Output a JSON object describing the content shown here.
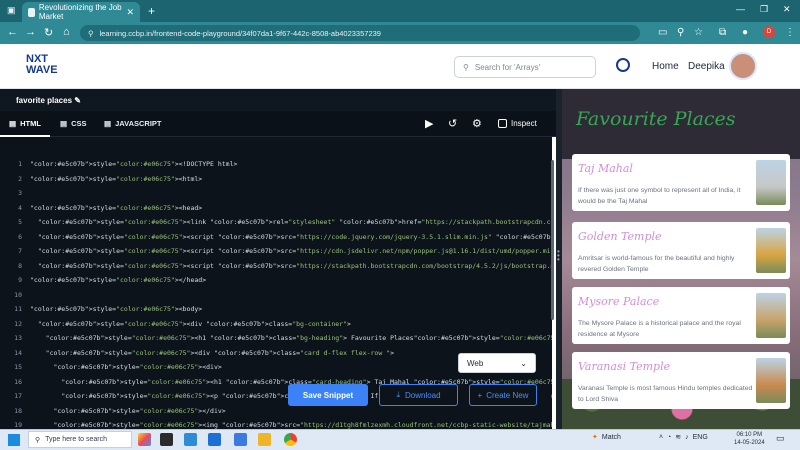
{
  "browser": {
    "tab_title": "Revolutionizing the Job Market",
    "url": "learning.ccbp.in/frontend-code-playground/34f07da1-9f67-442c-8508-ab4023357239",
    "profile_initial": "D"
  },
  "site": {
    "logo_line1": "NXT",
    "logo_line2": "WAVE",
    "search_placeholder": "Search for 'Arrays'",
    "nav_home": "Home",
    "user_name": "Deepika"
  },
  "editor": {
    "title": "favorite places",
    "tabs": [
      "HTML",
      "CSS",
      "JAVASCRIPT"
    ],
    "active_tab": "HTML",
    "inspect_label": "Inspect",
    "lines": [
      {
        "n": "1",
        "t": "<!DOCTYPE html>"
      },
      {
        "n": "2",
        "t": "<html>"
      },
      {
        "n": "3",
        "t": ""
      },
      {
        "n": "4",
        "t": "<head>"
      },
      {
        "n": "5",
        "t": "  <link rel=\"stylesheet\" href=\"https://stackpath.bootstrapcdn.com/bootstrap/4.5.2/css/bootstrap.min.css\" integrity="
      },
      {
        "n": "6",
        "t": "  <script src=\"https://code.jquery.com/jquery-3.5.1.slim.min.js\" integrity=\"sha384-DfXdz2htPH0lsSSs5nCTpuj/zy4C+OGp"
      },
      {
        "n": "7",
        "t": "  <script src=\"https://cdn.jsdelivr.net/npm/popper.js@1.16.1/dist/umd/popper.min.js\" integrity=\"sha384-9/reFTGAW83E"
      },
      {
        "n": "8",
        "t": "  <script src=\"https://stackpath.bootstrapcdn.com/bootstrap/4.5.2/js/bootstrap.min.js\" integrity=\"sha384-B4gt1jrGC7"
      },
      {
        "n": "9",
        "t": "</head>"
      },
      {
        "n": "10",
        "t": ""
      },
      {
        "n": "11",
        "t": "<body>"
      },
      {
        "n": "12",
        "t": "  <div class=\"bg-container\">"
      },
      {
        "n": "13",
        "t": "    <h1 class=\"bg-heading\"> Favourite Places</h1>"
      },
      {
        "n": "14",
        "t": "    <div class=\"card d-flex flex-row \">"
      },
      {
        "n": "15",
        "t": "      <div>"
      },
      {
        "n": "16",
        "t": "        <h1 class=\"card-heading\"> Taj Mahal </h1>"
      },
      {
        "n": "17",
        "t": "        <p class=\"card-content\"> If there was just                             res            it                     j"
      },
      {
        "n": "18",
        "t": "      </div>"
      },
      {
        "n": "19",
        "t": "      <img src=\"https://d1tgh8fmlzexmh.cloudfront.net/ccbp-static-website/tajmahal-img.png\" class=\"image\" />"
      }
    ]
  },
  "controls": {
    "language": "Web",
    "save": "Save Snippet",
    "download": "Download",
    "new": "Create New"
  },
  "preview": {
    "heading": "Favourite Places",
    "cards": [
      {
        "title": "Taj Mahal",
        "text": "If there was just one symbol to represent all of India, it would be the Taj Mahal",
        "color": "#c7c7c7"
      },
      {
        "title": "Golden Temple",
        "text": "Amritsar is world-famous for the beautiful and highly revered Golden Temple",
        "color": "#d9a441"
      },
      {
        "title": "Mysore Palace",
        "text": "The Mysore Palace is a historical palace and the royal residence at Mysore",
        "color": "#c9a36a"
      },
      {
        "title": "Varanasi Temple",
        "text": "Varanasi Temple is most famous Hindu temples dedicated to Lord Shiva",
        "color": "#c98a4e"
      }
    ]
  },
  "taskbar": {
    "search_placeholder": "Type here to search",
    "weather": "Match",
    "lang": "ENG",
    "time": "06:10 PM",
    "date": "14-05-2024"
  }
}
